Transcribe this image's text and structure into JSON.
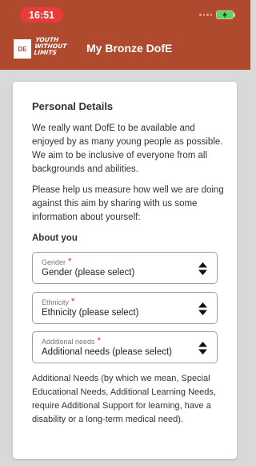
{
  "status_bar": {
    "time": "16:51"
  },
  "header": {
    "logo_badge": "DE",
    "logo_text_line1": "YOUTH",
    "logo_text_line2": "WITHOUT",
    "logo_text_line3": "LIMITS",
    "title": "My Bronze DofE",
    "color": "#b04a2f"
  },
  "card": {
    "title": "Personal Details",
    "intro": "We really want DofE to be available and enjoyed by as many young people as possible. We aim to be inclusive of everyone from all backgrounds and abilities.",
    "request": "Please help us measure how well we are doing against this aim by sharing with us some information about yourself:",
    "about_heading": "About you",
    "fields": [
      {
        "label": "Gender",
        "required_mark": "*",
        "value": "Gender (please select)"
      },
      {
        "label": "Ethnicity",
        "required_mark": "*",
        "value": "Ethnicity (please select)"
      },
      {
        "label": "Additional needs",
        "required_mark": "*",
        "value": "Additional needs (please select)"
      }
    ],
    "note": "Additional Needs (by which we mean, Special Educational Needs, Additional Learning Needs, require Additional Support for learning, have a disability or a long-term medical need)."
  }
}
